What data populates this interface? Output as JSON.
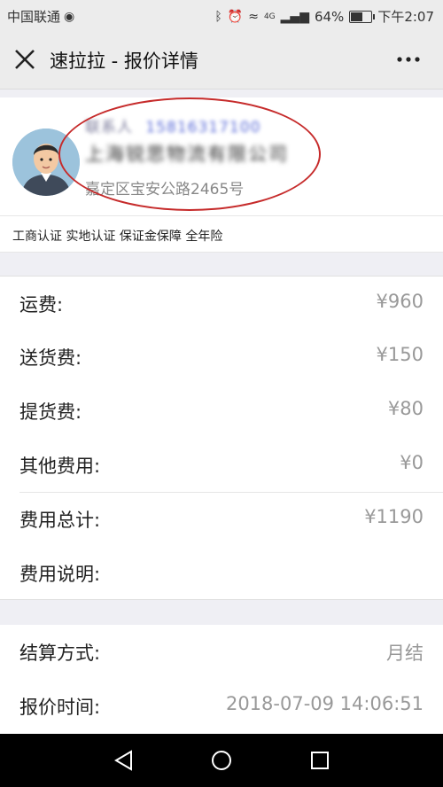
{
  "status_bar": {
    "carrier": "中国联通",
    "battery": "64%",
    "battery_fraction": 0.64,
    "time": "下午2:07",
    "network": "4G"
  },
  "header": {
    "title": "速拉拉 - 报价详情",
    "close_icon": "close-icon",
    "more_icon": "more-icon"
  },
  "company": {
    "contact_label": "联系人",
    "phone": "15816317100",
    "name": "上海锐思物流有限公司",
    "address": "嘉定区宝安公路2465号",
    "avatar_icon": "user-avatar-icon"
  },
  "tags": "工商认证  实地认证  保证金保障  全年险",
  "fees": [
    {
      "label": "运费:",
      "value": "¥960"
    },
    {
      "label": "送货费:",
      "value": "¥150"
    },
    {
      "label": "提货费:",
      "value": "¥80"
    },
    {
      "label": "其他费用:",
      "value": "¥0"
    },
    {
      "label": "费用总计:",
      "value": "¥1190"
    },
    {
      "label": "费用说明:",
      "value": ""
    }
  ],
  "settlement": [
    {
      "label": "结算方式:",
      "value": "月结"
    },
    {
      "label": "报价时间:",
      "value": "2018-07-09 14:06:51"
    }
  ],
  "colors": {
    "accent_red": "#c62b2b",
    "value_gray": "#999999",
    "background_gray": "#efeff4"
  }
}
